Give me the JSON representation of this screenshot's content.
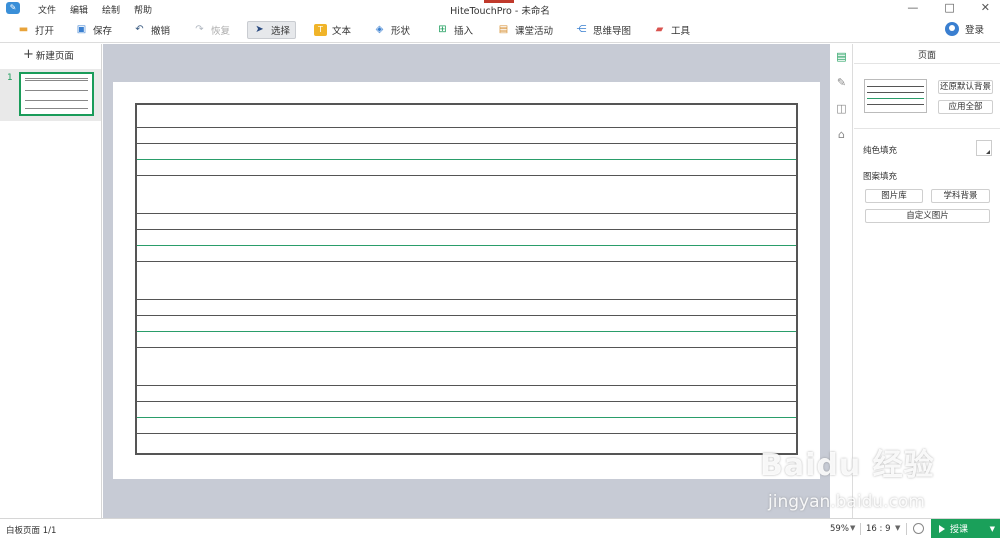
{
  "window": {
    "title": "HiteTouchPro - 未命名",
    "menu": [
      "文件",
      "编辑",
      "绘制",
      "帮助"
    ],
    "controls": [
      "—",
      "□",
      "✕"
    ],
    "accent_color": "#1a9c5a"
  },
  "toolbar": {
    "open": "打开",
    "save": "保存",
    "undo": "撤销",
    "redo": "恢复",
    "select": "选择",
    "text": "文本",
    "shape": "形状",
    "insert": "插入",
    "class_activity": "课堂活动",
    "mind_map": "思维导图",
    "tools": "工具",
    "login": "登录"
  },
  "left_panel": {
    "new_page": "新建页面",
    "pages": [
      {
        "number": "1"
      }
    ]
  },
  "right_panel": {
    "title": "页面",
    "restore_default_bg": "还原默认背景",
    "apply_all": "应用全部",
    "solid_fill": "纯色填充",
    "pattern_fill": "图案填充",
    "image_library": "图片库",
    "subject_bg": "学科背景",
    "custom_image": "自定义图片"
  },
  "statusbar": {
    "page_info": "白板页面 1/1",
    "zoom": "59%",
    "ratio": "16 : 9",
    "lesson": "授课"
  },
  "watermark": {
    "brand": "Baidu 经验",
    "url": "jingyan.baidu.com"
  }
}
